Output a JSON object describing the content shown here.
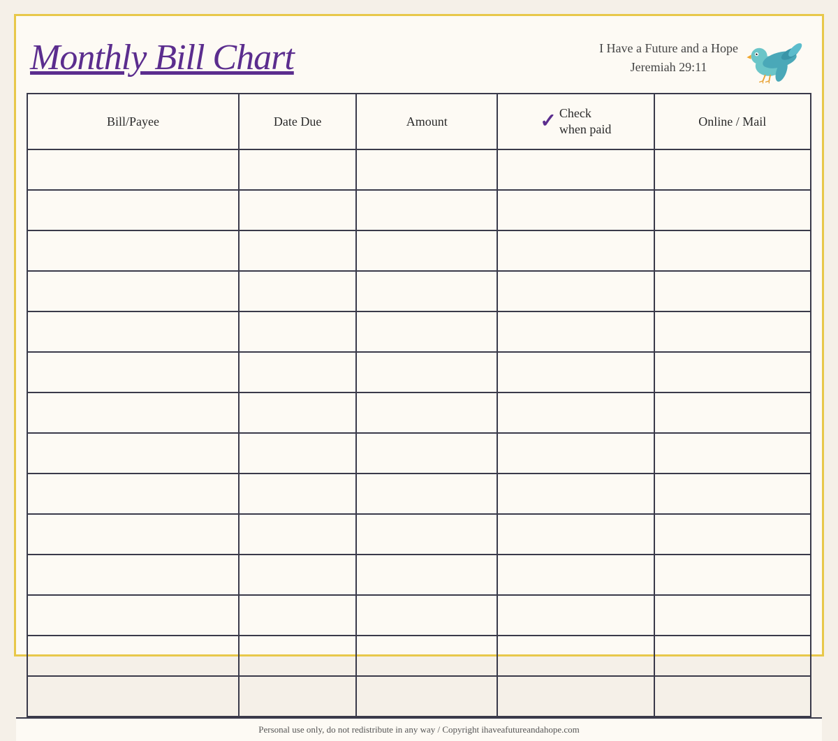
{
  "header": {
    "title": "Monthly Bill Chart",
    "tagline_line1": "I Have a Future and a Hope",
    "tagline_line2": "Jeremiah 29:11"
  },
  "table": {
    "columns": [
      {
        "id": "bill",
        "label": "Bill/Payee"
      },
      {
        "id": "date",
        "label": "Date Due"
      },
      {
        "id": "amount",
        "label": "Amount"
      },
      {
        "id": "check",
        "label_line1": "Check",
        "label_line2": "when paid",
        "checkmark": "✓"
      },
      {
        "id": "online",
        "label": "Online / Mail"
      }
    ],
    "row_count": 14
  },
  "footer": {
    "text": "Personal use only, do not redistribute in any way / Copyright ihaveafutureandahope.com"
  },
  "colors": {
    "title_purple": "#5b2d8e",
    "border_dark": "#3a3a4a",
    "background": "#fdfaf4",
    "outer_border": "#e8c84a"
  }
}
